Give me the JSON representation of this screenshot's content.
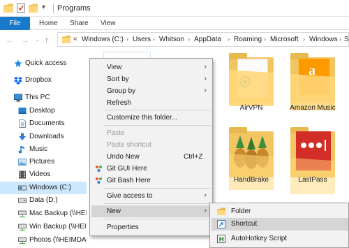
{
  "window": {
    "title": "Programs"
  },
  "ribbon": {
    "tabs": [
      "File",
      "Home",
      "Share",
      "View"
    ]
  },
  "address": {
    "prefix": "«",
    "crumbs": [
      "Windows (C:)",
      "Users",
      "Whitson",
      "AppData",
      "Roaming",
      "Microsoft",
      "Windows",
      "S"
    ]
  },
  "nav": {
    "items": [
      {
        "label": "Quick access",
        "icon": "star-icon",
        "color": "#1e88e5"
      },
      {
        "label": "Dropbox",
        "icon": "dropbox-icon",
        "color": "#0061ff"
      },
      {
        "label": "This PC",
        "icon": "computer-icon",
        "color": "#3a8fd6"
      },
      {
        "label": "Desktop",
        "icon": "desktop-icon",
        "color": "#2d7fd0"
      },
      {
        "label": "Documents",
        "icon": "documents-icon",
        "color": "#7d8fa3"
      },
      {
        "label": "Downloads",
        "icon": "downloads-icon",
        "color": "#2d7fd0"
      },
      {
        "label": "Music",
        "icon": "music-icon",
        "color": "#2d7fd0"
      },
      {
        "label": "Pictures",
        "icon": "pictures-icon",
        "color": "#6aa0c9"
      },
      {
        "label": "Videos",
        "icon": "videos-icon",
        "color": "#555555"
      },
      {
        "label": "Windows (C:)",
        "icon": "drive-icon",
        "color": "#6d6d6d"
      },
      {
        "label": "Data (D:)",
        "icon": "drive-icon",
        "color": "#6d6d6d"
      },
      {
        "label": "Mac Backup (\\\\HEIM",
        "icon": "network-drive-icon",
        "color": "#4caf50"
      },
      {
        "label": "Win Backup (\\\\HEIM",
        "icon": "network-drive-icon",
        "color": "#4caf50"
      },
      {
        "label": "Photos (\\\\HEIMDAL",
        "icon": "network-drive-icon",
        "color": "#4caf50"
      }
    ]
  },
  "folders": [
    {
      "label": "AirVPN"
    },
    {
      "label": "Amazon Music"
    },
    {
      "label": "HandBrake"
    },
    {
      "label": "LastPass"
    }
  ],
  "context_menu": {
    "items": [
      {
        "label": "View",
        "submenu": true
      },
      {
        "label": "Sort by",
        "submenu": true
      },
      {
        "label": "Group by",
        "submenu": true
      },
      {
        "label": "Refresh"
      },
      {
        "label": "Customize this folder..."
      },
      {
        "label": "Paste",
        "disabled": true
      },
      {
        "label": "Paste shortcut",
        "disabled": true
      },
      {
        "label": "Undo New",
        "shortcut": "Ctrl+Z"
      },
      {
        "label": "Git GUI Here",
        "icon": "git-icon"
      },
      {
        "label": "Git Bash Here",
        "icon": "git-icon"
      },
      {
        "label": "Give access to",
        "submenu": true
      },
      {
        "label": "New",
        "submenu": true,
        "highlighted": true
      },
      {
        "label": "Properties"
      }
    ]
  },
  "new_submenu": {
    "items": [
      {
        "label": "Folder",
        "icon": "folder-icon"
      },
      {
        "label": "Shortcut",
        "icon": "shortcut-icon",
        "highlighted": true
      },
      {
        "label": "AutoHotkey Script",
        "icon": "autohotkey-icon"
      }
    ]
  },
  "colors": {
    "accent": "#1979ca",
    "selection": "#cce8ff",
    "folder": "#f2c561",
    "amazon": "#ff9900",
    "lastpass": "#d32d27"
  }
}
